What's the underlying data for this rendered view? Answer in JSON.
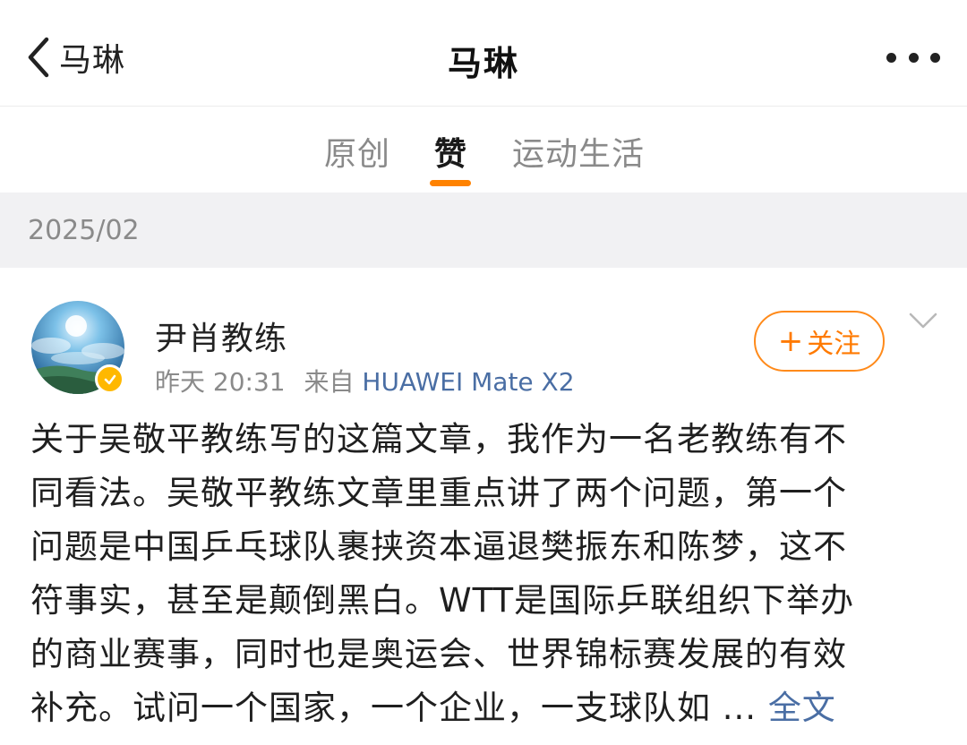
{
  "nav": {
    "back_label": "马琳",
    "title": "马琳",
    "back_icon": "chevron-left-icon",
    "more_icon": "more-dots-icon"
  },
  "tabs": [
    {
      "label": "原创",
      "active": false
    },
    {
      "label": "赞",
      "active": true
    },
    {
      "label": "运动生活",
      "active": false
    }
  ],
  "accent_color": "#ff8200",
  "date_group": "2025/02",
  "post": {
    "author": "尹肖教练",
    "time": "昨天 20:31",
    "source_prefix": "来自",
    "device": "HUAWEI Mate X2",
    "verified_badge": "verified-badge-icon",
    "follow_label": "关注",
    "follow_plus": "+",
    "lines": [
      "关于吴敬平教练写的这篇文章，我作为一名老教练有不",
      "同看法。吴敬平教练文章里重点讲了两个问题，第一个",
      "问题是中国乒乓球队裹挟资本逼退樊振东和陈梦，这不",
      "符事实，甚至是颠倒黑白。WTT是国际乒联组织下举办",
      "的商业赛事，同时也是奥运会、世界锦标赛发展的有效",
      "补充。试问一个国家，一个企业，一支球队如 ..."
    ],
    "more_label": "全文"
  }
}
